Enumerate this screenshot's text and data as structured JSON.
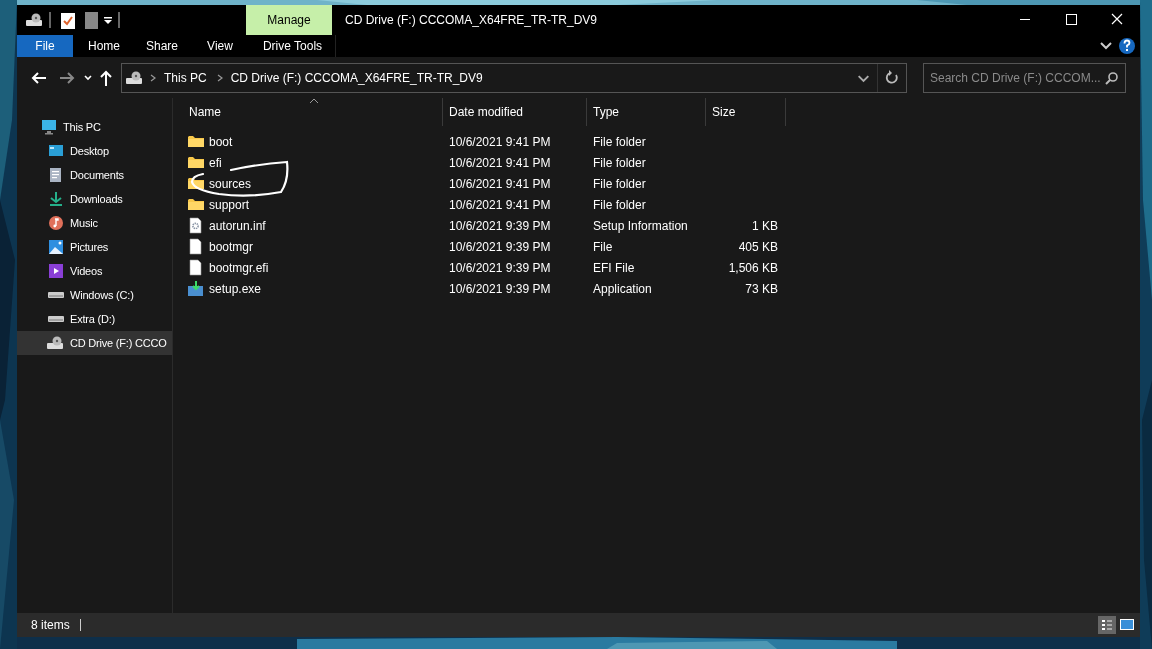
{
  "window": {
    "title": "CD Drive (F:) CCCOMA_X64FRE_TR-TR_DV9"
  },
  "ribbon": {
    "context_tab": "Manage",
    "tabs": [
      {
        "label": "File",
        "kind": "file",
        "selected": false
      },
      {
        "label": "Home",
        "kind": "tab",
        "selected": false
      },
      {
        "label": "Share",
        "kind": "tab",
        "selected": false
      },
      {
        "label": "View",
        "kind": "tab",
        "selected": false
      },
      {
        "label": "Drive Tools",
        "kind": "context",
        "selected": false
      }
    ]
  },
  "address_bar": {
    "breadcrumbs": [
      "This PC",
      "CD Drive (F:) CCCOMA_X64FRE_TR-TR_DV9"
    ]
  },
  "search": {
    "placeholder": "Search CD Drive (F:) CCCOM..."
  },
  "sidebar": {
    "items": [
      {
        "label": "This PC",
        "kind": "pc",
        "selected": false,
        "children": [
          {
            "label": "Desktop",
            "kind": "desktop",
            "selected": false
          },
          {
            "label": "Documents",
            "kind": "documents",
            "selected": false
          },
          {
            "label": "Downloads",
            "kind": "downloads",
            "selected": false
          },
          {
            "label": "Music",
            "kind": "music",
            "selected": false
          },
          {
            "label": "Pictures",
            "kind": "pictures",
            "selected": false
          },
          {
            "label": "Videos",
            "kind": "videos",
            "selected": false
          },
          {
            "label": "Windows (C:)",
            "kind": "drive",
            "selected": false
          },
          {
            "label": "Extra (D:)",
            "kind": "drive",
            "selected": false
          },
          {
            "label": "CD Drive (F:) CCCO",
            "kind": "cd",
            "selected": true
          }
        ]
      }
    ]
  },
  "table": {
    "columns": [
      "Name",
      "Date modified",
      "Type",
      "Size"
    ],
    "rows": [
      {
        "name": "boot",
        "date": "10/6/2021 9:41 PM",
        "type": "File folder",
        "kind": "folder"
      },
      {
        "name": "efi",
        "date": "10/6/2021 9:41 PM",
        "type": "File folder",
        "kind": "folder"
      },
      {
        "name": "sources",
        "date": "10/6/2021 9:41 PM",
        "type": "File folder",
        "kind": "folder"
      },
      {
        "name": "support",
        "date": "10/6/2021 9:41 PM",
        "type": "File folder",
        "kind": "folder"
      },
      {
        "name": "autorun.inf",
        "date": "10/6/2021 9:39 PM",
        "type": "Setup Information",
        "size": "1 KB",
        "kind": "settings"
      },
      {
        "name": "bootmgr",
        "date": "10/6/2021 9:39 PM",
        "type": "File",
        "size": "405 KB",
        "kind": "file"
      },
      {
        "name": "bootmgr.efi",
        "date": "10/6/2021 9:39 PM",
        "type": "EFI File",
        "size": "1,506 KB",
        "kind": "file"
      },
      {
        "name": "setup.exe",
        "date": "10/6/2021 9:39 PM",
        "type": "Application",
        "size": "73 KB",
        "kind": "setup"
      }
    ]
  },
  "status_bar": {
    "item_count": "8 items"
  }
}
